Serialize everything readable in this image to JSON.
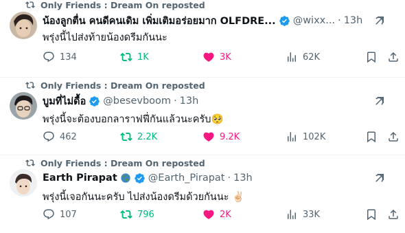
{
  "colors": {
    "verified": "#1d9bf0",
    "retweeted": "#00ba7c",
    "liked": "#f91880",
    "muted": "#536471",
    "text": "#0f1419"
  },
  "tweets": [
    {
      "repost_label": "Only Friends : Dream On reposted",
      "name": "น้องลูกตื่น คนดีคนเดิม เพิ่มเติมอร่อยมาก OLFDRE...",
      "handle": "@wixx...",
      "dot": "·",
      "time": "13h",
      "text": "พรุ่งนี้ไปส่งท้ายน้องดรีมกันนะ",
      "replies": "134",
      "retweets": "1K",
      "likes": "3K",
      "views": "62K"
    },
    {
      "repost_label": "Only Friends : Dream On reposted",
      "name": "บูมที่ไม่ดื้อ",
      "handle": "@besevboom",
      "dot": "·",
      "time": "13h",
      "text": "พรุ่งนี้จะต้องบอกลาราฟฟี่กันแล้วนะครับ🥺",
      "replies": "462",
      "retweets": "2.2K",
      "likes": "9.2K",
      "views": "102K"
    },
    {
      "repost_label": "Only Friends : Dream On reposted",
      "name": "Earth Pirapat",
      "handle": "@Earth_Pirapat",
      "dot": "·",
      "time": "13h",
      "text": "พรุ่งนี้เจอกันนะครับ ไปส่งน้องดรีมด้วยกันนะ ✌🏻",
      "replies": "107",
      "retweets": "796",
      "likes": "2K",
      "views": "33K"
    }
  ]
}
